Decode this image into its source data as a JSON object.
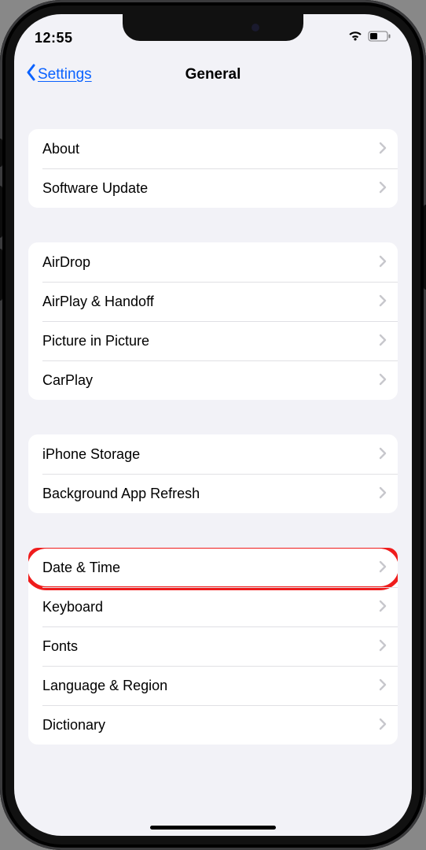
{
  "status": {
    "time": "12:55"
  },
  "nav": {
    "back": "Settings",
    "title": "General"
  },
  "groups": [
    {
      "rows": [
        {
          "k": "about",
          "label": "About"
        },
        {
          "k": "swupdate",
          "label": "Software Update"
        }
      ]
    },
    {
      "rows": [
        {
          "k": "airdrop",
          "label": "AirDrop"
        },
        {
          "k": "airplay",
          "label": "AirPlay & Handoff"
        },
        {
          "k": "pip",
          "label": "Picture in Picture"
        },
        {
          "k": "carplay",
          "label": "CarPlay"
        }
      ]
    },
    {
      "rows": [
        {
          "k": "storage",
          "label": "iPhone Storage"
        },
        {
          "k": "bgapp",
          "label": "Background App Refresh"
        }
      ]
    },
    {
      "rows": [
        {
          "k": "datetime",
          "label": "Date & Time",
          "highlight": true
        },
        {
          "k": "keyboard",
          "label": "Keyboard"
        },
        {
          "k": "fonts",
          "label": "Fonts"
        },
        {
          "k": "langreg",
          "label": "Language & Region"
        },
        {
          "k": "dict",
          "label": "Dictionary"
        }
      ]
    }
  ]
}
